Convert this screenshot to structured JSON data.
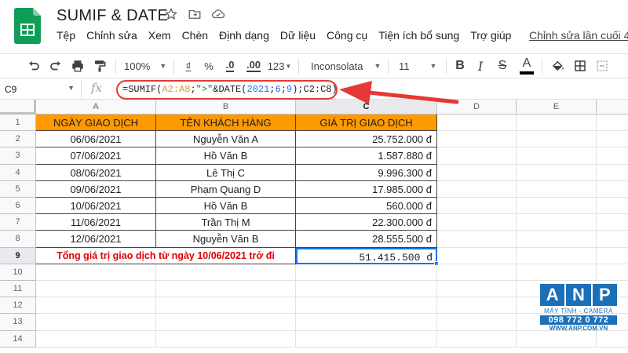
{
  "title_bar": {
    "doc_title": "SUMIF & DATE",
    "star_icon": "star-outline-icon",
    "move_icon": "folder-move-icon",
    "cloud_icon": "cloud-saved-icon"
  },
  "menu": {
    "items": [
      "Tệp",
      "Chỉnh sửa",
      "Xem",
      "Chèn",
      "Định dạng",
      "Dữ liệu",
      "Công cụ",
      "Tiện ích bổ sung",
      "Trợ giúp"
    ],
    "last_edit": "Chỉnh sửa lần cuối 4"
  },
  "toolbar": {
    "zoom": "100%",
    "currency": "₫",
    "percent": "%",
    "dec_decrease": ".0",
    "dec_increase": ".00",
    "more_formats": "123",
    "font": "Inconsolata",
    "font_size": "11",
    "bold": "B",
    "italic": "I",
    "strike": "S",
    "text_color": "A"
  },
  "formula_bar": {
    "name_box": "C9",
    "fx": "fx",
    "f_p1": "=SUMIF(",
    "f_r1": "A2:A8",
    "f_p2": ";",
    "f_s1": "\">\"",
    "f_p3": "&DATE(",
    "f_n1": "2021",
    "f_p4": ";",
    "f_n2": "6",
    "f_p5": ";",
    "f_n3": "9",
    "f_p6": ");C2:C8)"
  },
  "grid": {
    "columns": [
      "A",
      "B",
      "C",
      "D",
      "E"
    ],
    "rows": [
      "1",
      "2",
      "3",
      "4",
      "5",
      "6",
      "7",
      "8",
      "9",
      "10",
      "11",
      "12",
      "13",
      "14"
    ],
    "headers": [
      "NGÀY GIAO DỊCH",
      "TÊN KHÁCH HÀNG",
      "GIÁ TRỊ GIAO DỊCH"
    ],
    "data": [
      [
        "06/06/2021",
        "Nguyễn Văn A",
        "25.752.000 đ"
      ],
      [
        "07/06/2021",
        "Hồ Văn B",
        "1.587.880 đ"
      ],
      [
        "08/06/2021",
        "Lê Thị C",
        "9.996.300 đ"
      ],
      [
        "09/06/2021",
        "Phạm Quang D",
        "17.985.000 đ"
      ],
      [
        "10/06/2021",
        "Hồ Văn B",
        "560.000 đ"
      ],
      [
        "11/06/2021",
        "Trần Thị M",
        "22.300.000 đ"
      ],
      [
        "12/06/2021",
        "Nguyễn Văn B",
        "28.555.500 đ"
      ]
    ],
    "total_label": "Tổng giá trị giao dịch từ ngày 10/06/2021 trở đi",
    "total_value": "51.415.500 đ"
  },
  "watermark": {
    "letters": [
      "A",
      "N",
      "P"
    ],
    "subtitle": "MÁY TÍNH - CAMERA",
    "phone": "098 772 0 772",
    "website": "WWW.ANP.COM.VN"
  },
  "colors": {
    "header_fill": "#ff9900",
    "total_text": "#e00000",
    "selection": "#1a73e8",
    "annotation": "#e53935",
    "sheets_green": "#0f9d58"
  }
}
